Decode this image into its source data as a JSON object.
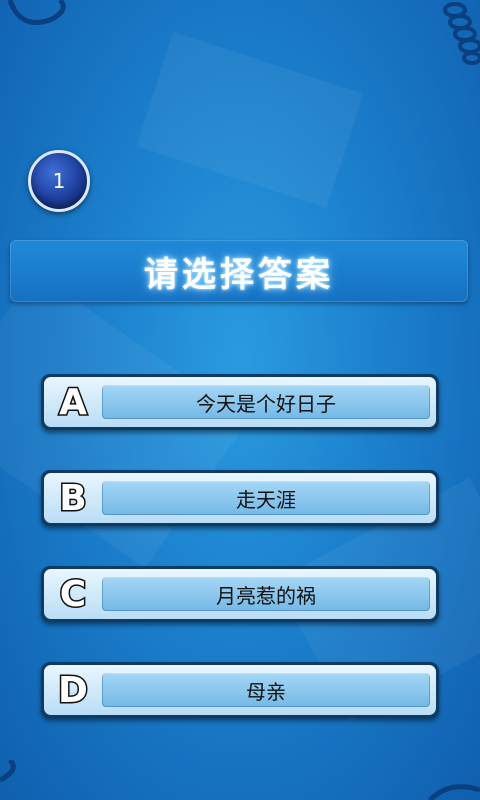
{
  "question": {
    "number": "1",
    "prompt": "请选择答案"
  },
  "options": [
    {
      "letter": "A",
      "text": "今天是个好日子"
    },
    {
      "letter": "B",
      "text": "走天涯"
    },
    {
      "letter": "C",
      "text": "月亮惹的祸"
    },
    {
      "letter": "D",
      "text": "母亲"
    }
  ],
  "colors": {
    "background": "#1b7fcc",
    "badge": "#1d3f9c",
    "option_frame": "#0e3a63",
    "answer_fill": "#a5d6f5"
  }
}
